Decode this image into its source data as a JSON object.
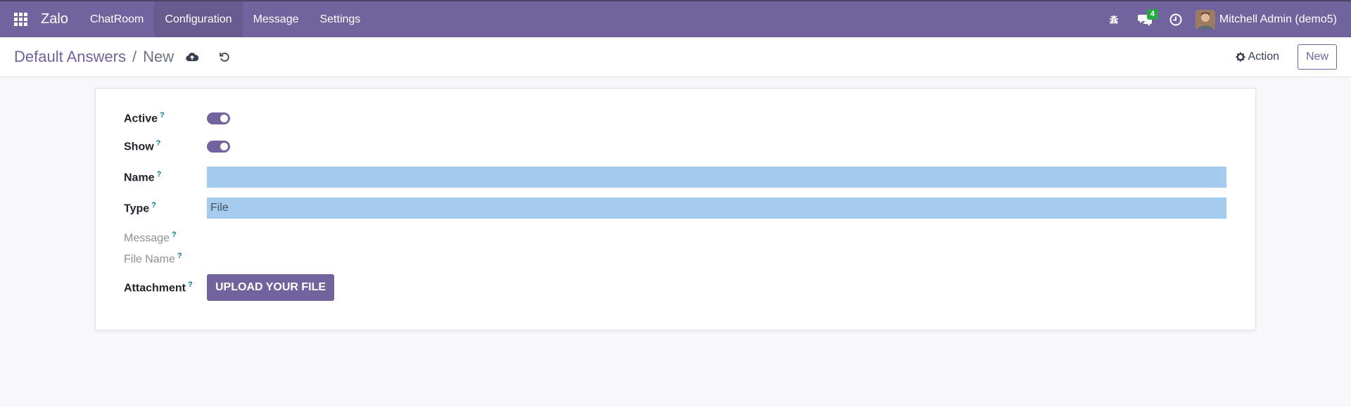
{
  "navbar": {
    "brand": "Zalo",
    "menu": [
      {
        "label": "ChatRoom",
        "active": false
      },
      {
        "label": "Configuration",
        "active": true
      },
      {
        "label": "Message",
        "active": false
      },
      {
        "label": "Settings",
        "active": false
      }
    ],
    "icons": [
      "bug-icon",
      "chat-icon",
      "clock-icon"
    ],
    "chat_badge": "4",
    "user_name": "Mitchell Admin (demo5)"
  },
  "control_panel": {
    "breadcrumb_parent": "Default Answers",
    "breadcrumb_separator": "/",
    "breadcrumb_current": "New",
    "action_label": "Action",
    "new_label": "New"
  },
  "form": {
    "active": {
      "label": "Active",
      "help": "?",
      "value": true
    },
    "show": {
      "label": "Show",
      "help": "?",
      "value": true
    },
    "name": {
      "label": "Name",
      "help": "?",
      "value": ""
    },
    "type": {
      "label": "Type",
      "help": "?",
      "value": "File"
    },
    "message": {
      "label": "Message",
      "help": "?"
    },
    "file_name": {
      "label": "File Name",
      "help": "?"
    },
    "attachment": {
      "label": "Attachment",
      "help": "?",
      "button": "UPLOAD YOUR FILE"
    }
  },
  "colors": {
    "primary": "#71639e",
    "input_highlight": "#a3ccef",
    "badge": "#28a745"
  }
}
